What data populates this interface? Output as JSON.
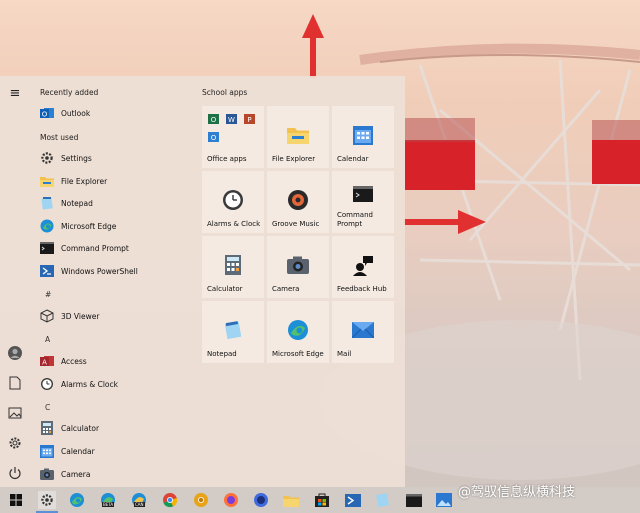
{
  "start_menu": {
    "hamburger": "≡",
    "recently_added_header": "Recently added",
    "most_used_header": "Most used",
    "recent": [
      {
        "label": "Outlook",
        "icon": "outlook-icon"
      }
    ],
    "most_used": [
      {
        "label": "Settings",
        "icon": "gear-icon"
      },
      {
        "label": "File Explorer",
        "icon": "folder-icon"
      },
      {
        "label": "Notepad",
        "icon": "notepad-icon"
      },
      {
        "label": "Microsoft Edge",
        "icon": "edge-icon"
      },
      {
        "label": "Command Prompt",
        "icon": "cmd-icon"
      },
      {
        "label": "Windows PowerShell",
        "icon": "powershell-icon"
      }
    ],
    "letters": [
      "#",
      "A",
      "C"
    ],
    "hash_apps": [
      {
        "label": "3D Viewer",
        "icon": "cube-icon"
      }
    ],
    "a_apps": [
      {
        "label": "Access",
        "icon": "access-icon"
      },
      {
        "label": "Alarms & Clock",
        "icon": "clock-icon"
      }
    ],
    "c_apps": [
      {
        "label": "Calculator",
        "icon": "calculator-icon"
      },
      {
        "label": "Calendar",
        "icon": "calendar-icon"
      },
      {
        "label": "Camera",
        "icon": "camera-icon"
      }
    ],
    "tiles_header": "School apps",
    "tiles": [
      {
        "label": "Office apps",
        "icon": "office-apps-icon"
      },
      {
        "label": "File Explorer",
        "icon": "folder-icon"
      },
      {
        "label": "Calendar",
        "icon": "calendar-icon"
      },
      {
        "label": "Alarms & Clock",
        "icon": "clock-icon"
      },
      {
        "label": "Groove Music",
        "icon": "groove-icon"
      },
      {
        "label": "Command Prompt",
        "icon": "cmd-icon"
      },
      {
        "label": "Calculator",
        "icon": "calculator-icon"
      },
      {
        "label": "Camera",
        "icon": "camera-icon"
      },
      {
        "label": "Feedback Hub",
        "icon": "feedback-icon"
      },
      {
        "label": "Notepad",
        "icon": "notepad-icon"
      },
      {
        "label": "Microsoft Edge",
        "icon": "edge-icon"
      },
      {
        "label": "Mail",
        "icon": "mail-icon"
      }
    ]
  },
  "taskbar": {
    "icons": [
      "windows-icon",
      "gear-icon",
      "edge-icon",
      "edge-beta-icon",
      "edge-canary-icon",
      "chrome-icon",
      "chrome-canary-icon",
      "firefox-icon",
      "firefox-nightly-icon",
      "folder-icon",
      "store-icon",
      "powershell-icon",
      "notepad-icon",
      "terminal-icon",
      "photos-icon"
    ],
    "edge_beta_badge": "BETA",
    "edge_canary_badge": "CAN"
  },
  "watermark": "@驾驭信息纵横科技",
  "colors": {
    "accent_red": "#e03030",
    "edge_blue": "#2d7fd2",
    "folder_yellow": "#f2c14e"
  }
}
